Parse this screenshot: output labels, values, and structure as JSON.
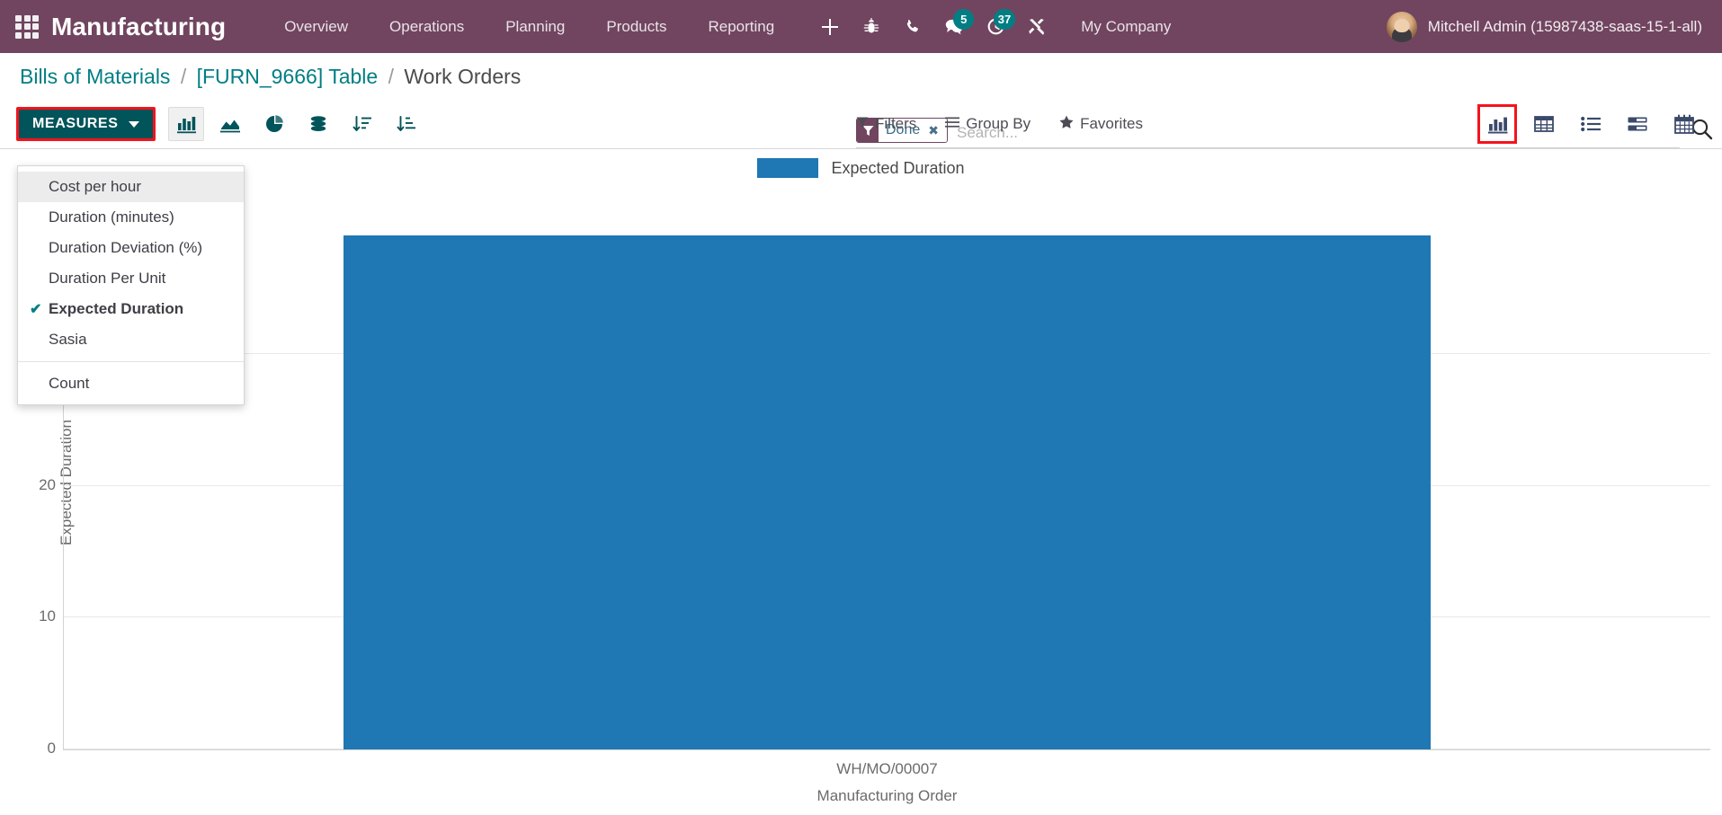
{
  "navbar": {
    "apps_icon": "apps-grid-icon",
    "brand": "Manufacturing",
    "menu": [
      {
        "label": "Overview"
      },
      {
        "label": "Operations"
      },
      {
        "label": "Planning"
      },
      {
        "label": "Products"
      },
      {
        "label": "Reporting"
      }
    ],
    "icons": [
      {
        "name": "plus-icon",
        "glyph": "+"
      },
      {
        "name": "bug-icon",
        "glyph": "bug"
      },
      {
        "name": "phone-icon",
        "glyph": "phone"
      },
      {
        "name": "messages-icon",
        "glyph": "chat",
        "badge": "5"
      },
      {
        "name": "activities-icon",
        "glyph": "clock",
        "badge": "37"
      },
      {
        "name": "tools-icon",
        "glyph": "wrench"
      }
    ],
    "company": "My Company",
    "username": "Mitchell Admin (15987438-saas-15-1-all)",
    "bg_color": "#71455f",
    "badge_color": "#017e84"
  },
  "breadcrumb": {
    "items": [
      {
        "label": "Bills of Materials",
        "active": false
      },
      {
        "label": "[FURN_9666] Table",
        "active": false
      },
      {
        "label": "Work Orders",
        "active": true
      }
    ],
    "separator": "/"
  },
  "search": {
    "facet": {
      "label": "Done",
      "icon": "filter-icon",
      "remove": "✖"
    },
    "placeholder": "Search...",
    "value": "",
    "search_icon": "search-icon"
  },
  "toolbar": {
    "measures_label": "MEASURES",
    "measures_highlight_color": "#f5121c",
    "measures_bg_color": "#01545a",
    "chart_type_buttons": [
      {
        "name": "bar-chart-icon",
        "active": true
      },
      {
        "name": "line-chart-icon",
        "active": false
      },
      {
        "name": "pie-chart-icon",
        "active": false
      },
      {
        "name": "stacked-icon",
        "active": false
      },
      {
        "name": "sort-descending-icon",
        "active": false
      },
      {
        "name": "sort-ascending-icon",
        "active": false
      }
    ],
    "filters": [
      {
        "label": "Filters",
        "icon": "filter-icon"
      },
      {
        "label": "Group By",
        "icon": "bars-icon"
      },
      {
        "label": "Favorites",
        "icon": "star-icon"
      }
    ],
    "views": [
      {
        "name": "graph-view-icon",
        "selected": true
      },
      {
        "name": "pivot-view-icon",
        "selected": false
      },
      {
        "name": "list-view-icon",
        "selected": false
      },
      {
        "name": "kanban-view-icon",
        "selected": false
      },
      {
        "name": "calendar-view-icon",
        "selected": false
      }
    ]
  },
  "measures_menu": {
    "items": [
      {
        "label": "Cost per hour",
        "checked": false,
        "highlighted": true
      },
      {
        "label": "Duration (minutes)",
        "checked": false,
        "highlighted": false
      },
      {
        "label": "Duration Deviation (%)",
        "checked": false,
        "highlighted": false
      },
      {
        "label": "Duration Per Unit",
        "checked": false,
        "highlighted": false
      },
      {
        "label": "Expected Duration",
        "checked": true,
        "highlighted": false
      },
      {
        "label": "Sasia",
        "checked": false,
        "highlighted": false
      }
    ],
    "footer_items": [
      {
        "label": "Count",
        "checked": false,
        "highlighted": false
      }
    ],
    "check_glyph": "✔"
  },
  "chart_data": {
    "type": "bar",
    "title": "",
    "categories": [
      "WH/MO/00007"
    ],
    "values": [
      39
    ],
    "series": [
      {
        "name": "Expected Duration",
        "values": [
          39
        ],
        "color": "#1f77b4"
      }
    ],
    "xlabel": "Manufacturing Order",
    "ylabel": "Expected Duration",
    "ylim": [
      0,
      40
    ],
    "yticks": [
      0,
      10,
      20,
      30
    ],
    "grid": true,
    "legend": {
      "position": "top",
      "entries": [
        "Expected Duration"
      ]
    }
  }
}
